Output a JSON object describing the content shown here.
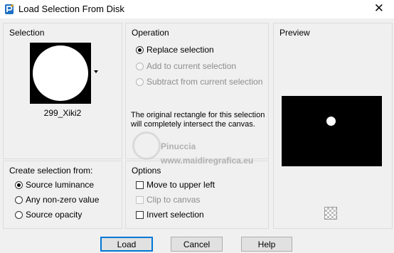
{
  "window": {
    "title": "Load Selection From Disk",
    "close_glyph": "✕"
  },
  "selection": {
    "title": "Selection",
    "file_name": "299_Xiki2"
  },
  "operation": {
    "title": "Operation",
    "options": [
      {
        "label": "Replace selection",
        "checked": true,
        "enabled": true
      },
      {
        "label": "Add to current selection",
        "checked": false,
        "enabled": false
      },
      {
        "label": "Subtract from current selection",
        "checked": false,
        "enabled": false
      }
    ],
    "message": "The original rectangle for this selection will completely intersect the canvas."
  },
  "preview": {
    "title": "Preview"
  },
  "create_from": {
    "title": "Create selection from:",
    "options": [
      {
        "label": "Source luminance",
        "checked": true
      },
      {
        "label": "Any non-zero value",
        "checked": false
      },
      {
        "label": "Source opacity",
        "checked": false
      }
    ]
  },
  "options": {
    "title": "Options",
    "items": [
      {
        "label": "Move to upper left",
        "checked": false,
        "enabled": true
      },
      {
        "label": "Clip to canvas",
        "checked": false,
        "enabled": false
      },
      {
        "label": "Invert selection",
        "checked": false,
        "enabled": true
      }
    ]
  },
  "watermark": {
    "name": "Pinuccia",
    "url": "www.maidiregrafica.eu"
  },
  "buttons": {
    "load": "Load",
    "cancel": "Cancel",
    "help": "Help"
  },
  "icons": {
    "app": "psp-app-icon",
    "close": "close-icon",
    "dropdown": "dropdown-arrow-icon",
    "transparency": "checkerboard-icon"
  },
  "colors": {
    "accent": "#0078d7",
    "panel_border": "#dcdcdc",
    "background": "#f0f0f0"
  }
}
